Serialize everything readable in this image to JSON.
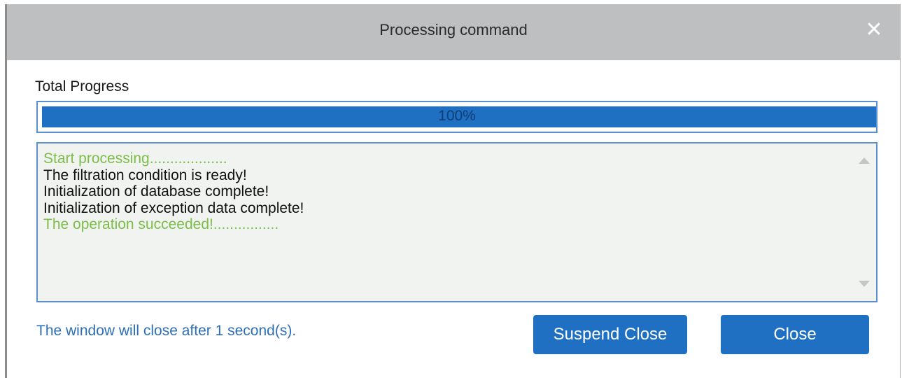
{
  "dialog": {
    "title": "Processing command",
    "close_icon": "close-icon"
  },
  "progress": {
    "label": "Total Progress",
    "value_text": "100%",
    "value_fraction": 1.0,
    "fill_color": "#1f6fc2"
  },
  "log": {
    "lines": [
      {
        "text": "Start processing...................",
        "color": "#7dbd4a"
      },
      {
        "text": "The filtration condition is ready!",
        "color": "#111111"
      },
      {
        "text": "Initialization of database complete!",
        "color": "#111111"
      },
      {
        "text": "Initialization of exception data complete!",
        "color": "#111111"
      },
      {
        "text": "The operation succeeded!................",
        "color": "#7dbd4a"
      }
    ],
    "scroll_up_icon": "chevron-up-icon",
    "scroll_down_icon": "chevron-down-icon"
  },
  "footer": {
    "countdown_text": "The window will close after 1 second(s).",
    "suspend_label": "Suspend Close",
    "close_label": "Close",
    "accent_color": "#1f6fc2"
  }
}
